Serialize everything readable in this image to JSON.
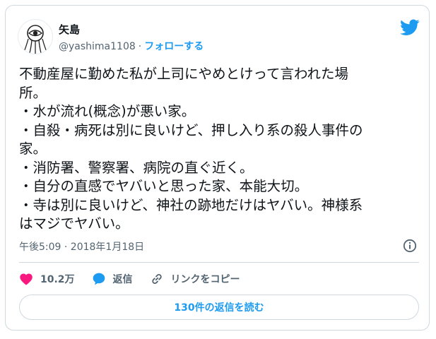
{
  "user": {
    "name": "矢島",
    "handle": "@yashima1108",
    "separator": "·",
    "follow_label": "フォローする"
  },
  "tweet": {
    "text": "不動産屋に勤めた私が上司にやめとけって言われた場\n所。\n・水が流れ(概念)が悪い家。\n・自殺・病死は別に良いけど、押し入り系の殺人事件の\n家。\n・消防署、警察署、病院の直ぐ近く。\n・自分の直感でヤバいと思った家、本能大切。\n・寺は別に良いけど、神社の跡地だけはヤバい。神様系\nはマジでヤバい。",
    "timestamp": "午後5:09 · 2018年1月18日"
  },
  "actions": {
    "likes": "10.2万",
    "reply_label": "返信",
    "copy_link_label": "リンクをコピー"
  },
  "replies_button": "130件の返信を読む",
  "icons": {
    "brand": "twitter-bird-icon",
    "like": "heart-icon",
    "reply": "speech-bubble-icon",
    "link": "link-icon",
    "info": "info-icon"
  },
  "colors": {
    "accent": "#1d9bf0",
    "like": "#f91880",
    "text": "#0f1419",
    "muted": "#536471",
    "border": "#cfd9de"
  }
}
